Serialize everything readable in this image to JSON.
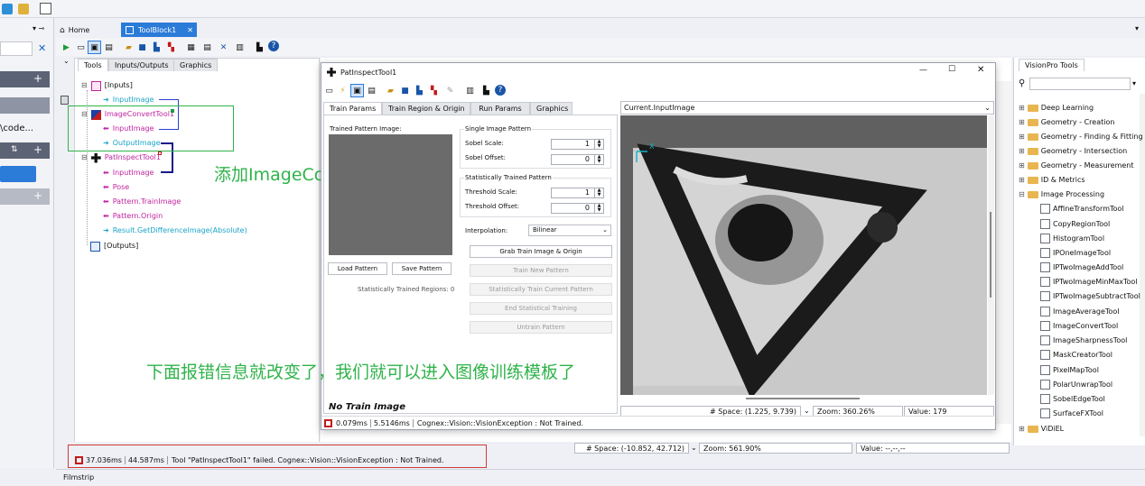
{
  "doc_tabs": {
    "home": "Home",
    "toolblock": "ToolBlock1"
  },
  "left_panel": {
    "text": "\\code..."
  },
  "toolblock": {
    "tabs": [
      "Tools",
      "Inputs/Outputs",
      "Graphics"
    ],
    "tree": [
      {
        "label": "[Inputs]",
        "cls": ""
      },
      {
        "label": "InputImage",
        "cls": "cy"
      },
      {
        "label": "ImageConvertTool1",
        "cls": "mag"
      },
      {
        "label": "InputImage",
        "cls": "mag"
      },
      {
        "label": "OutputImage",
        "cls": "cy"
      },
      {
        "label": "PatInspectTool1",
        "cls": "mag"
      },
      {
        "label": "InputImage",
        "cls": "mag"
      },
      {
        "label": "Pose",
        "cls": "mag"
      },
      {
        "label": "Pattern.TrainImage",
        "cls": "mag"
      },
      {
        "label": "Pattern.Origin",
        "cls": "mag"
      },
      {
        "label": "Result.GetDifferenceImage(Absolute)",
        "cls": "cy"
      },
      {
        "label": "[Outputs]",
        "cls": ""
      }
    ],
    "status": {
      "time1": "37.036ms",
      "time2": "44.587ms",
      "message": "Tool \"PatInspectTool1\" failed. Cognex::Vision::VisionException : Not Trained."
    },
    "space": "# Space: (-10.852, 42.712)",
    "zoom": "Zoom: 561.90%",
    "value": "Value: --,--,--"
  },
  "annotations": {
    "add_tool": "添加ImageConvertTool",
    "note": "下面报错信息就改变了，我们就可以进入图像训练模板了"
  },
  "dialog": {
    "title": "PatInspectTool1",
    "tabs": [
      "Train Params",
      "Train Region & Origin",
      "Run Params",
      "Graphics"
    ],
    "trained_pattern_label": "Trained Pattern Image:",
    "load_pattern": "Load Pattern",
    "save_pattern": "Save Pattern",
    "stat_regions": "Statistically Trained Regions: 0",
    "no_train": "No Train Image",
    "single_group": "Single Image Pattern",
    "sobel_scale": {
      "label": "Sobel Scale:",
      "value": "1"
    },
    "sobel_offset": {
      "label": "Sobel Offset:",
      "value": "0"
    },
    "stat_group": "Statistically Trained Pattern",
    "threshold_scale": {
      "label": "Threshold Scale:",
      "value": "1"
    },
    "threshold_offset": {
      "label": "Threshold Offset:",
      "value": "0"
    },
    "interp": {
      "label": "Interpolation:",
      "value": "Bilinear"
    },
    "buttons": [
      "Grab Train Image & Origin",
      "Train New Pattern",
      "Statistically Train Current Pattern",
      "End Statistical Training",
      "Untrain Pattern"
    ],
    "image_select": "Current.InputImage",
    "axis_x": "X",
    "space": "# Space: (1.225, 9.739)",
    "zoom": "Zoom: 360.26%",
    "value": "Value: 179",
    "status": {
      "time1": "0.079ms",
      "time2": "5.5146ms",
      "message": "Cognex::Vision::VisionException : Not Trained."
    }
  },
  "vision_tools": {
    "tab": "VisionPro Tools",
    "items": [
      {
        "label": "Deep Learning",
        "folder": true
      },
      {
        "label": "Geometry - Creation",
        "folder": true
      },
      {
        "label": "Geometry - Finding & Fitting",
        "folder": true
      },
      {
        "label": "Geometry - Intersection",
        "folder": true
      },
      {
        "label": "Geometry - Measurement",
        "folder": true
      },
      {
        "label": "ID & Metrics",
        "folder": true
      },
      {
        "label": "Image Processing",
        "folder": true
      },
      {
        "label": "AffineTransformTool",
        "folder": false
      },
      {
        "label": "CopyRegionTool",
        "folder": false
      },
      {
        "label": "HistogramTool",
        "folder": false
      },
      {
        "label": "IPOneImageTool",
        "folder": false
      },
      {
        "label": "IPTwoImageAddTool",
        "folder": false
      },
      {
        "label": "IPTwoImageMinMaxTool",
        "folder": false
      },
      {
        "label": "IPTwoImageSubtractTool",
        "folder": false
      },
      {
        "label": "ImageAverageTool",
        "folder": false
      },
      {
        "label": "ImageConvertTool",
        "folder": false
      },
      {
        "label": "ImageSharpnessTool",
        "folder": false
      },
      {
        "label": "MaskCreatorTool",
        "folder": false
      },
      {
        "label": "PixelMapTool",
        "folder": false
      },
      {
        "label": "PolarUnwrapTool",
        "folder": false
      },
      {
        "label": "SobelEdgeTool",
        "folder": false
      },
      {
        "label": "SurfaceFXTool",
        "folder": false
      },
      {
        "label": "ViDiEL",
        "folder": true
      }
    ]
  },
  "filmstrip": "Filmstrip"
}
